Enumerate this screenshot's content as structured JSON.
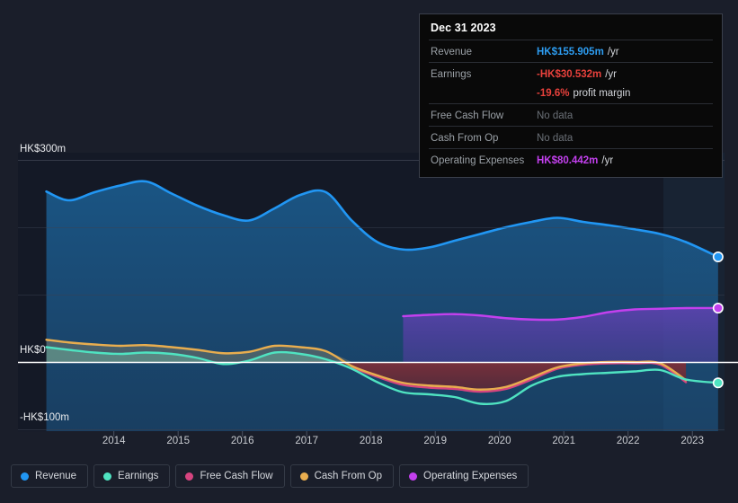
{
  "chart_data": {
    "type": "area",
    "title": "",
    "xlabel": "",
    "ylabel": "",
    "currency": "HK$",
    "units": "m",
    "grid": true,
    "legend_position": "bottom",
    "xlim": [
      2013.4,
      2024.0
    ],
    "ylim": [
      -133,
      300
    ],
    "y_ticks": [
      {
        "value": 300,
        "label": "HK$300m"
      },
      {
        "value": 200,
        "label": ""
      },
      {
        "value": 100,
        "label": ""
      },
      {
        "value": 0,
        "label": "HK$0"
      },
      {
        "value": -100,
        "label": "-HK$100m"
      }
    ],
    "y_axis_labels": [
      "HK$300m",
      "HK$0",
      "-HK$100m"
    ],
    "x_ticks": [
      "2014",
      "2015",
      "2016",
      "2017",
      "2018",
      "2019",
      "2020",
      "2021",
      "2022",
      "2023"
    ],
    "x": [
      2013.45,
      2013.8,
      2014.2,
      2014.6,
      2015.0,
      2015.4,
      2015.8,
      2016.2,
      2016.6,
      2017.0,
      2017.4,
      2017.8,
      2018.2,
      2018.6,
      2019.0,
      2019.4,
      2019.8,
      2020.2,
      2020.6,
      2021.0,
      2021.4,
      2021.8,
      2022.2,
      2022.6,
      2023.0,
      2023.4,
      2023.9
    ],
    "series": [
      {
        "name": "Revenue",
        "color": "#2196f3",
        "fill": "rgba(33,124,187,0.38)",
        "end_value": 155.905,
        "values": [
          253,
          240,
          252,
          262,
          268,
          250,
          232,
          218,
          210,
          228,
          248,
          252,
          210,
          178,
          167,
          170,
          180,
          190,
          200,
          208,
          214,
          208,
          203,
          197,
          190,
          178,
          156
        ]
      },
      {
        "name": "Earnings",
        "color": "#4fe3c1",
        "fill": "rgba(79,227,193,0.22)",
        "end_value": -30.532,
        "values": [
          22,
          18,
          14,
          12,
          14,
          12,
          6,
          -3,
          2,
          14,
          12,
          4,
          -10,
          -30,
          -45,
          -48,
          -52,
          -62,
          -58,
          -35,
          -22,
          -18,
          -16,
          -14,
          -12,
          -26,
          -31
        ]
      },
      {
        "name": "Free Cash Flow",
        "color": "#d6447f",
        "fill": "rgba(214,68,127,0.20)",
        "end_value": null,
        "end_note": "No data",
        "values": [
          null,
          null,
          null,
          null,
          null,
          null,
          null,
          null,
          null,
          null,
          null,
          null,
          -8,
          -22,
          -34,
          -38,
          -40,
          -44,
          -40,
          -26,
          -10,
          -4,
          -2,
          -2,
          -4,
          -30,
          null
        ]
      },
      {
        "name": "Cash From Op",
        "color": "#e8ad4f",
        "fill": "rgba(232,173,79,0.20)",
        "end_value": null,
        "end_note": "No data",
        "values": [
          33,
          29,
          26,
          24,
          25,
          22,
          18,
          13,
          15,
          24,
          22,
          16,
          -6,
          -20,
          -31,
          -35,
          -37,
          -41,
          -37,
          -23,
          -8,
          -2,
          0,
          0,
          -2,
          -27,
          null
        ]
      },
      {
        "name": "Operating Expenses",
        "color": "#c340ee",
        "fill": "rgba(120,60,200,0.42)",
        "end_value": 80.442,
        "start_x": 2019.0,
        "values": [
          null,
          null,
          null,
          null,
          null,
          null,
          null,
          null,
          null,
          null,
          null,
          null,
          null,
          null,
          68,
          70,
          71,
          69,
          65,
          63,
          63,
          67,
          74,
          78,
          79,
          80,
          80
        ]
      }
    ]
  },
  "tooltip": {
    "title": "Dec 31 2023",
    "rows": [
      {
        "label": "Revenue",
        "value": "HK$155.905m",
        "suffix": "/yr",
        "style": "rev"
      },
      {
        "label": "Earnings",
        "value": "-HK$30.532m",
        "suffix": "/yr",
        "style": "earn"
      },
      {
        "label": "",
        "value": "-19.6%",
        "suffix": "profit margin",
        "style": "margin"
      },
      {
        "label": "Free Cash Flow",
        "value": "No data",
        "suffix": "",
        "style": "nodata"
      },
      {
        "label": "Cash From Op",
        "value": "No data",
        "suffix": "",
        "style": "nodata"
      },
      {
        "label": "Operating Expenses",
        "value": "HK$80.442m",
        "suffix": "/yr",
        "style": "opex"
      }
    ]
  },
  "legend": {
    "items": [
      {
        "label": "Revenue",
        "color": "#2196f3"
      },
      {
        "label": "Earnings",
        "color": "#4fe3c1"
      },
      {
        "label": "Free Cash Flow",
        "color": "#d6447f"
      },
      {
        "label": "Cash From Op",
        "color": "#e8ad4f"
      },
      {
        "label": "Operating Expenses",
        "color": "#c340ee"
      }
    ]
  },
  "colors": {
    "background": "#1a1e2a",
    "plot_background": "#121622",
    "gridline": "#39404f",
    "zeroline": "#ffffff",
    "highlight_band": "rgba(60,110,150,0.16)"
  }
}
